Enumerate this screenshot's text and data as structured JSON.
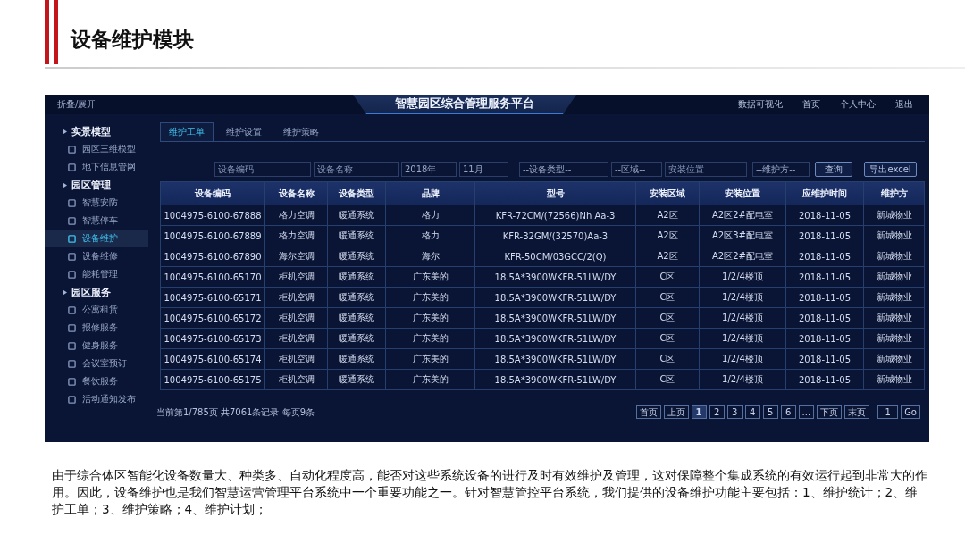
{
  "slide": {
    "title": "设备维护模块",
    "description": "由于综合体区智能化设备数量大、种类多、自动化程度高，能否对这些系统设备的进行及时有效维护及管理，这对保障整个集成系统的有效运行起到非常大的作用。因此，设备维护也是我们智慧运营管理平台系统中一个重要功能之一。针对智慧管控平台系统，我们提供的设备维护功能主要包括：1、维护统计；2、维护工单；3、维护策略；4、维护计划；"
  },
  "app": {
    "collapse_toggle": "折叠/展开",
    "title": "智慧园区综合管理服务平台",
    "nav": [
      "数据可视化",
      "首页",
      "个人中心",
      "退出"
    ],
    "sidebar": [
      {
        "label": "实景模型",
        "children": [
          {
            "label": "园区三维模型",
            "selected": false
          },
          {
            "label": "地下信息管网",
            "selected": false
          }
        ]
      },
      {
        "label": "园区管理",
        "children": [
          {
            "label": "智慧安防",
            "selected": false
          },
          {
            "label": "智慧停车",
            "selected": false
          },
          {
            "label": "设备维护",
            "selected": true
          },
          {
            "label": "设备维修",
            "selected": false
          },
          {
            "label": "能耗管理",
            "selected": false
          }
        ]
      },
      {
        "label": "园区服务",
        "children": [
          {
            "label": "公寓租赁",
            "selected": false
          },
          {
            "label": "报修服务",
            "selected": false
          },
          {
            "label": "健身服务",
            "selected": false
          },
          {
            "label": "会议室预订",
            "selected": false
          },
          {
            "label": "餐饮服务",
            "selected": false
          },
          {
            "label": "活动通知发布",
            "selected": false
          }
        ]
      }
    ],
    "tabs": [
      {
        "label": "维护工单",
        "selected": true
      },
      {
        "label": "维护设置",
        "selected": false
      },
      {
        "label": "维护策略",
        "selected": false
      }
    ],
    "filters": [
      {
        "kind": "input",
        "placeholder": "设备编码"
      },
      {
        "kind": "input",
        "placeholder": "设备名称"
      },
      {
        "kind": "select",
        "value": "2018年"
      },
      {
        "kind": "select",
        "value": "11月"
      },
      {
        "kind": "select",
        "value": "--设备类型--"
      },
      {
        "kind": "select",
        "value": "--区域--"
      },
      {
        "kind": "input",
        "placeholder": "安装位置"
      },
      {
        "kind": "select",
        "value": "--维护方--"
      }
    ],
    "buttons": [
      "查询",
      "导出excel"
    ],
    "table": {
      "columns": [
        "设备编码",
        "设备名称",
        "设备类型",
        "品牌",
        "型号",
        "安装区域",
        "安装位置",
        "应维护时间",
        "维护方"
      ],
      "rows": [
        [
          "1004975-6100-67888",
          "格力空调",
          "暖通系统",
          "格力",
          "KFR-72CM/(72566)Nh Aa-3",
          "A2区",
          "A2区2#配电室",
          "2018-11-05",
          "新城物业"
        ],
        [
          "1004975-6100-67889",
          "格力空调",
          "暖通系统",
          "格力",
          "KFR-32GM/(32570)Aa-3",
          "A2区",
          "A2区3#配电室",
          "2018-11-05",
          "新城物业"
        ],
        [
          "1004975-6100-67890",
          "海尔空调",
          "暖通系统",
          "海尔",
          "KFR-50CM/03GCC/2(Q)",
          "A2区",
          "A2区2#配电室",
          "2018-11-05",
          "新城物业"
        ],
        [
          "1004975-6100-65170",
          "柜机空调",
          "暖通系统",
          "广东美的",
          "18.5A*3900WKFR-51LW/DY",
          "C区",
          "1/2/4楼顶",
          "2018-11-05",
          "新城物业"
        ],
        [
          "1004975-6100-65171",
          "柜机空调",
          "暖通系统",
          "广东美的",
          "18.5A*3900WKFR-51LW/DY",
          "C区",
          "1/2/4楼顶",
          "2018-11-05",
          "新城物业"
        ],
        [
          "1004975-6100-65172",
          "柜机空调",
          "暖通系统",
          "广东美的",
          "18.5A*3900WKFR-51LW/DY",
          "C区",
          "1/2/4楼顶",
          "2018-11-05",
          "新城物业"
        ],
        [
          "1004975-6100-65173",
          "柜机空调",
          "暖通系统",
          "广东美的",
          "18.5A*3900WKFR-51LW/DY",
          "C区",
          "1/2/4楼顶",
          "2018-11-05",
          "新城物业"
        ],
        [
          "1004975-6100-65174",
          "柜机空调",
          "暖通系统",
          "广东美的",
          "18.5A*3900WKFR-51LW/DY",
          "C区",
          "1/2/4楼顶",
          "2018-11-05",
          "新城物业"
        ],
        [
          "1004975-6100-65175",
          "柜机空调",
          "暖通系统",
          "广东美的",
          "18.5A*3900WKFR-51LW/DY",
          "C区",
          "1/2/4楼顶",
          "2018-11-05",
          "新城物业"
        ]
      ]
    },
    "summary": "当前第1/785页 共7061条记录 每页9条",
    "pagination": [
      {
        "label": "首页",
        "selected": false
      },
      {
        "label": "上页",
        "selected": false
      },
      {
        "label": "1",
        "selected": true
      },
      {
        "label": "2",
        "selected": false
      },
      {
        "label": "3",
        "selected": false
      },
      {
        "label": "4",
        "selected": false
      },
      {
        "label": "5",
        "selected": false
      },
      {
        "label": "6",
        "selected": false
      },
      {
        "label": "...",
        "selected": false
      },
      {
        "label": "下页",
        "selected": false
      },
      {
        "label": "末页",
        "selected": false
      }
    ],
    "page_input": "1",
    "go_button": "Go"
  }
}
